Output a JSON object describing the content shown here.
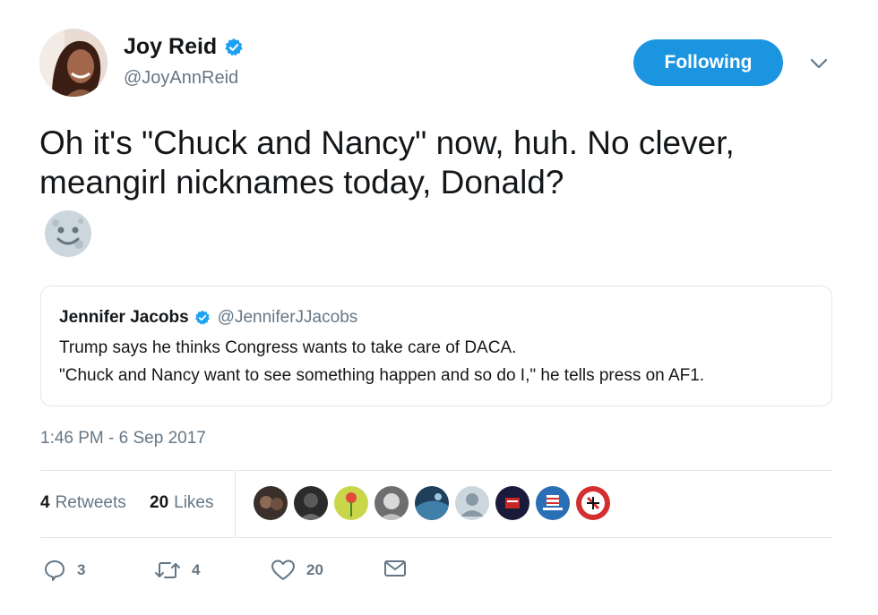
{
  "author": {
    "name": "Joy Reid",
    "handle": "@JoyAnnReid",
    "verified": true,
    "avatar_icon": "profile-photo"
  },
  "follow_button": {
    "label": "Following",
    "color": "#1b95e0"
  },
  "menu": {
    "icon": "chevron-down-icon"
  },
  "tweet": {
    "text": "Oh it's \"Chuck and Nancy\" now, huh. No clever, meangirl nicknames today, Donald?",
    "emoji_icon": "full-moon-face-emoji"
  },
  "quoted_tweet": {
    "name": "Jennifer Jacobs",
    "handle": "@JenniferJJacobs",
    "verified": true,
    "line1": "Trump says he thinks Congress wants to take care of DACA.",
    "line2": "\"Chuck and Nancy want to see something happen and so do I,\" he tells press on AF1."
  },
  "timestamp": "1:46 PM - 6 Sep 2017",
  "stats": {
    "retweets_count": "4",
    "retweets_label": "Retweets",
    "likes_count": "20",
    "likes_label": "Likes"
  },
  "likers": [
    {
      "icon": "liker-avatar-1",
      "color": "#3a2f2a"
    },
    {
      "icon": "liker-avatar-2",
      "color": "#2b2b2b"
    },
    {
      "icon": "liker-avatar-3",
      "color": "#c9d64a"
    },
    {
      "icon": "liker-avatar-4",
      "color": "#8a8a8a"
    },
    {
      "icon": "liker-avatar-5",
      "color": "#3f7fa8"
    },
    {
      "icon": "liker-avatar-6",
      "color": "#ccd6dd"
    },
    {
      "icon": "liker-avatar-7",
      "color": "#1a1a3a"
    },
    {
      "icon": "liker-avatar-8",
      "color": "#2a6fb5"
    },
    {
      "icon": "liker-avatar-9",
      "color": "#d32f2f"
    }
  ],
  "actions": {
    "reply_count": "3",
    "retweet_count": "4",
    "like_count": "20",
    "reply_icon": "reply-icon",
    "retweet_icon": "retweet-icon",
    "like_icon": "heart-icon",
    "dm_icon": "envelope-icon"
  },
  "colors": {
    "accent": "#1b95e0",
    "secondary_text": "#657786",
    "divider": "#e1e8ed"
  }
}
